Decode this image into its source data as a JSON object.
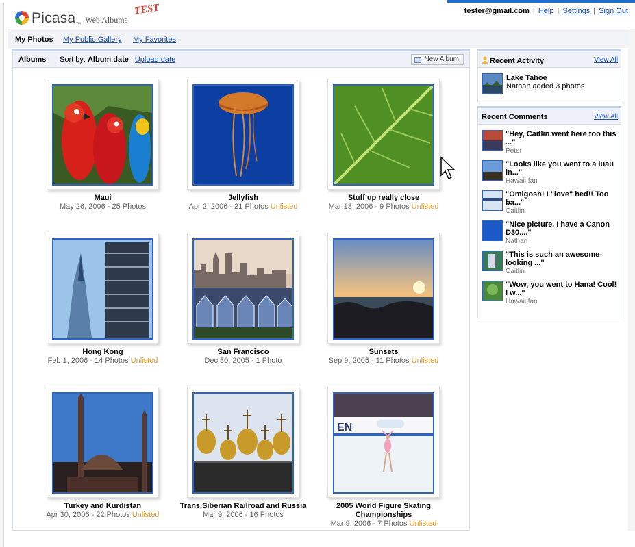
{
  "header": {
    "app_name": "Picasa",
    "app_sub": "Web Albums",
    "test_badge": "TEST",
    "email": "tester@gmail.com",
    "links": [
      "Help",
      "Settings",
      "Sign Out"
    ]
  },
  "subnav": {
    "current": "My Photos",
    "links": [
      "My Public Gallery",
      "My Favorites"
    ]
  },
  "albums_bar": {
    "label": "Albums",
    "sort_prefix": "Sort by:",
    "sort_active": "Album date",
    "sort_sep": "|",
    "sort_other": "Upload date",
    "new_album": "New Album"
  },
  "albums": [
    {
      "name": "Maui",
      "meta": "May 26, 2006 - 25 Photos",
      "unlisted": ""
    },
    {
      "name": "Jellyfish",
      "meta": "Apr 2, 2006 - 21 Photos",
      "unlisted": "Unlisted"
    },
    {
      "name": "Stuff up really close",
      "meta": "Mar 13, 2006 - 9 Photos",
      "unlisted": "Unlisted"
    },
    {
      "name": "Hong Kong",
      "meta": "Feb 1, 2006 - 14 Photos",
      "unlisted": "Unlisted"
    },
    {
      "name": "San Francisco",
      "meta": "Dec 30, 2005 - 1 Photo",
      "unlisted": ""
    },
    {
      "name": "Sunsets",
      "meta": "Sep 9, 2005 - 11 Photos",
      "unlisted": "Unlisted"
    },
    {
      "name": "Turkey and Kurdistan",
      "meta": "Apr 30, 2006 - 22 Photos",
      "unlisted": "Unlisted"
    },
    {
      "name": "Trans.Siberian Railroad and Russia",
      "meta": "Mar 9, 2006 - 16 Photos",
      "unlisted": ""
    },
    {
      "name": "2005 World Figure Skating Championships",
      "meta": "Mar 9, 2006 - 7 Photos",
      "unlisted": "Unlisted"
    }
  ],
  "recent_activity": {
    "title": "Recent Activity",
    "view_all": "View All",
    "items": [
      {
        "title": "Lake Tahoe",
        "text": "Nathan added 3 photos."
      }
    ]
  },
  "recent_comments": {
    "title": "Recent Comments",
    "view_all": "View All",
    "items": [
      {
        "quote": "\"Hey, Caitlin went here too this ...\"",
        "who": "Peter"
      },
      {
        "quote": "\"Looks like you went to a luau in...\"",
        "who": "Hawaii fan"
      },
      {
        "quote": "\"Omigosh! I \"love\" hed!! Too ba...\"",
        "who": "Caitlin"
      },
      {
        "quote": "\"Nice picture. I have a Canon D30....\"",
        "who": "Nathan"
      },
      {
        "quote": "\"This is such an awesome-looking ...\"",
        "who": "Caitlin"
      },
      {
        "quote": "\"Wow, you went to Hana! Cool! I w...\"",
        "who": "Hawaii fan"
      }
    ]
  },
  "colors": {
    "link": "#1a4eb5",
    "unlisted": "#f39a2a",
    "thumb_border": "#2b63c7",
    "test_badge": "#e03a2a"
  }
}
